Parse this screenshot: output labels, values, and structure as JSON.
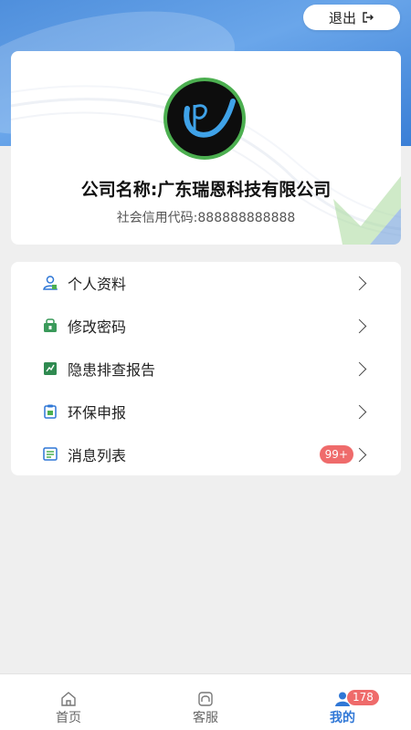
{
  "header": {
    "logout_label": "退出",
    "logout_icon": "logout-icon"
  },
  "profile": {
    "company_name": "公司名称:广东瑞恩科技有限公司",
    "credit_code": "社会信用代码:888888888888"
  },
  "menu": {
    "items": [
      {
        "label": "个人资料",
        "icon": "user-icon"
      },
      {
        "label": "修改密码",
        "icon": "lock-icon"
      },
      {
        "label": "隐患排查报告",
        "icon": "report-icon"
      },
      {
        "label": "环保申报",
        "icon": "clipboard-icon"
      },
      {
        "label": "消息列表",
        "icon": "message-list-icon",
        "badge": "99+"
      }
    ]
  },
  "tabbar": {
    "tabs": [
      {
        "label": "首页",
        "icon": "home-icon"
      },
      {
        "label": "客服",
        "icon": "customer-service-icon"
      },
      {
        "label": "我的",
        "icon": "user-filled-icon",
        "badge": "178",
        "active": true
      }
    ]
  },
  "colors": {
    "header_blue": "#4f8fdc",
    "accent_green": "#4caf50",
    "badge_red": "#ef6b6b",
    "active_tab": "#2f77d6"
  }
}
